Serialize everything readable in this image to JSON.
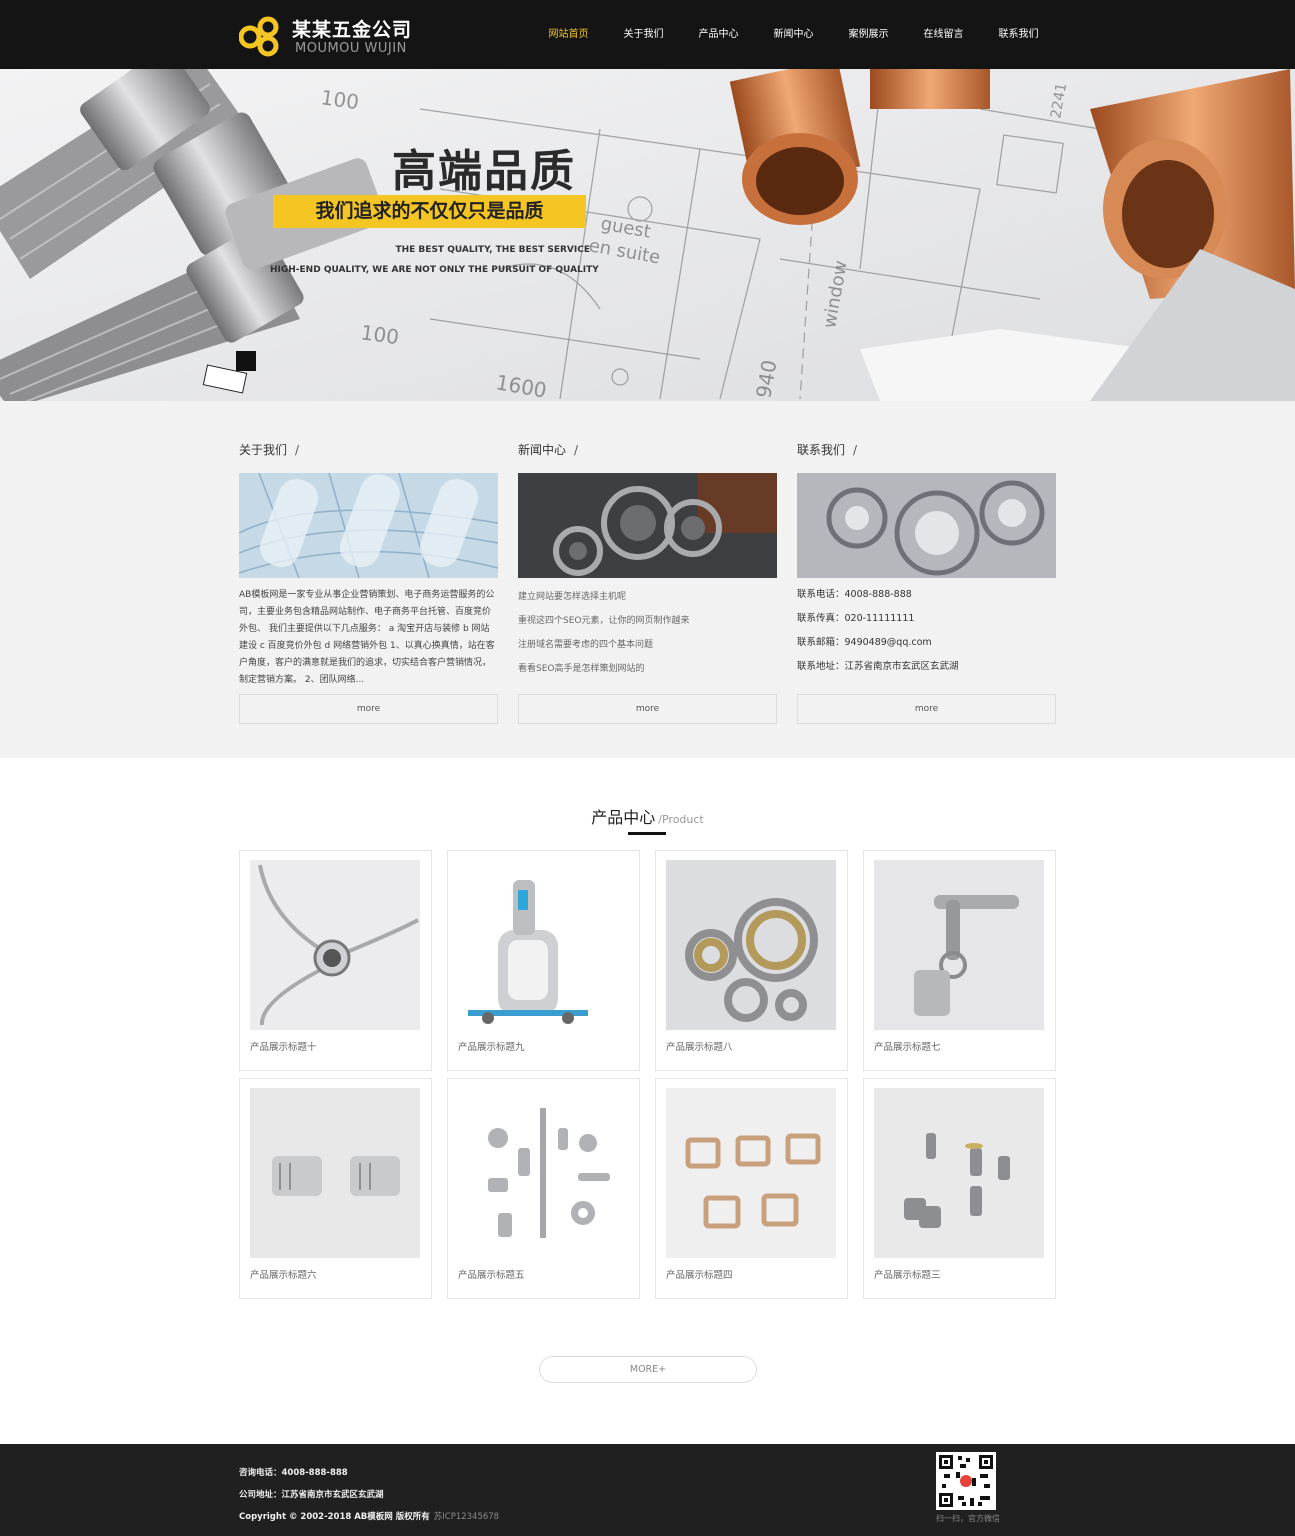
{
  "header": {
    "logo_title": "某某五金公司",
    "logo_sub": "MOUMOU WUJIN",
    "nav": [
      {
        "label": "网站首页",
        "active": true
      },
      {
        "label": "关于我们"
      },
      {
        "label": "产品中心"
      },
      {
        "label": "新闻中心"
      },
      {
        "label": "案例展示"
      },
      {
        "label": "在线留言"
      },
      {
        "label": "联系我们"
      }
    ]
  },
  "banner": {
    "title": "高端品质",
    "subtitle": "我们追求的不仅仅只是品质",
    "en_line1": "THE BEST QUALITY, THE BEST SERVICE",
    "en_line2": "HIGH-END QUALITY, WE ARE NOT ONLY THE PURSUIT OF QUALITY"
  },
  "about": {
    "title": "关于我们",
    "slash": "/",
    "text": "AB模板网是一家专业从事企业营销策划、电子商务运营服务的公司，主要业务包含精品网站制作、电子商务平台托管、百度竞价外包、 我们主要提供以下几点服务： a 淘宝开店与装修 b 网站建设 c 百度竞价外包 d 网络营销外包 1、以真心换真情，站在客户角度，客户的满意就是我们的追求，切实结合客户营销情况，制定营销方案。 2、团队网络...",
    "more": "more"
  },
  "news": {
    "title": "新闻中心",
    "slash": "/",
    "items": [
      "建立网站要怎样选择主机呢",
      "重视这四个SEO元素，让你的网页制作越来",
      "注册域名需要考虑的四个基本问题",
      "看看SEO高手是怎样策划网站的"
    ],
    "more": "more"
  },
  "contact": {
    "title": "联系我们",
    "slash": "/",
    "items": [
      "联系电话：4008-888-888",
      "联系传真：020-11111111",
      "联系邮箱：9490489@qq.com",
      "联系地址：江苏省南京市玄武区玄武湖"
    ],
    "more": "more"
  },
  "products": {
    "heading": "产品中心",
    "heading_en": "/Product",
    "items": [
      {
        "label": "产品展示标题十"
      },
      {
        "label": "产品展示标题九"
      },
      {
        "label": "产品展示标题八"
      },
      {
        "label": "产品展示标题七"
      },
      {
        "label": "产品展示标题六"
      },
      {
        "label": "产品展示标题五"
      },
      {
        "label": "产品展示标题四"
      },
      {
        "label": "产品展示标题三"
      }
    ],
    "more": "MORE+"
  },
  "footer": {
    "phone": "咨询电话：4008-888-888",
    "address": "公司地址：江苏省南京市玄武区玄武湖",
    "copyright": "Copyright © 2002-2018 AB模板网 版权所有",
    "icp": "苏ICP12345678",
    "qr_caption": "扫一扫，官方微信"
  },
  "colors": {
    "accent": "#f5c623",
    "header_bg": "#141414",
    "footer_bg": "#202020",
    "info_bg": "#f2f2f2"
  }
}
